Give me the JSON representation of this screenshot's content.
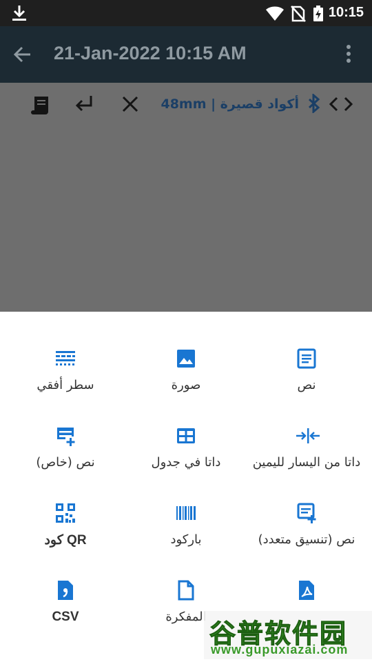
{
  "status_bar": {
    "time": "10:15",
    "icons": [
      "download-icon",
      "wifi-icon",
      "no-sim-icon",
      "battery-charging-icon"
    ]
  },
  "app_bar": {
    "title": "21-Jan-2022 10:15 AM",
    "icons": [
      "back-arrow-icon",
      "more-vert-icon"
    ]
  },
  "toolbar": {
    "printer_label": "أكواد قصيرة | 48mm",
    "icons": [
      "receipt-icon",
      "enter-icon",
      "close-icon",
      "bluetooth-icon",
      "code-icon"
    ]
  },
  "sheet": {
    "items": [
      {
        "label": "نص",
        "icon": "text-doc-icon"
      },
      {
        "label": "صورة",
        "icon": "image-icon"
      },
      {
        "label": "سطر أفقي",
        "icon": "horizontal-line-icon"
      },
      {
        "label": "داتا من اليسار لليمين",
        "icon": "align-center-icon"
      },
      {
        "label": "داتا في جدول",
        "icon": "table-icon"
      },
      {
        "label": "نص (خاص)",
        "icon": "text-add-icon"
      },
      {
        "label": "نص (تنسيق متعدد)",
        "icon": "text-add-icon"
      },
      {
        "label": "باركود",
        "icon": "barcode-icon"
      },
      {
        "label": "كود QR",
        "icon": "qr-code-icon"
      },
      {
        "label": "",
        "icon": "pdf-icon"
      },
      {
        "label": "المفكرة",
        "icon": "note-file-icon"
      },
      {
        "label": "CSV",
        "icon": "csv-file-icon"
      }
    ]
  },
  "watermark": {
    "cn": "谷普软件园",
    "url": "www.gupuxiazai.com"
  },
  "colors": {
    "accent": "#1976d2",
    "status_bar": "#1f1f1f",
    "app_bar": "#1c2a33",
    "scrim": "#6e6e6e"
  }
}
